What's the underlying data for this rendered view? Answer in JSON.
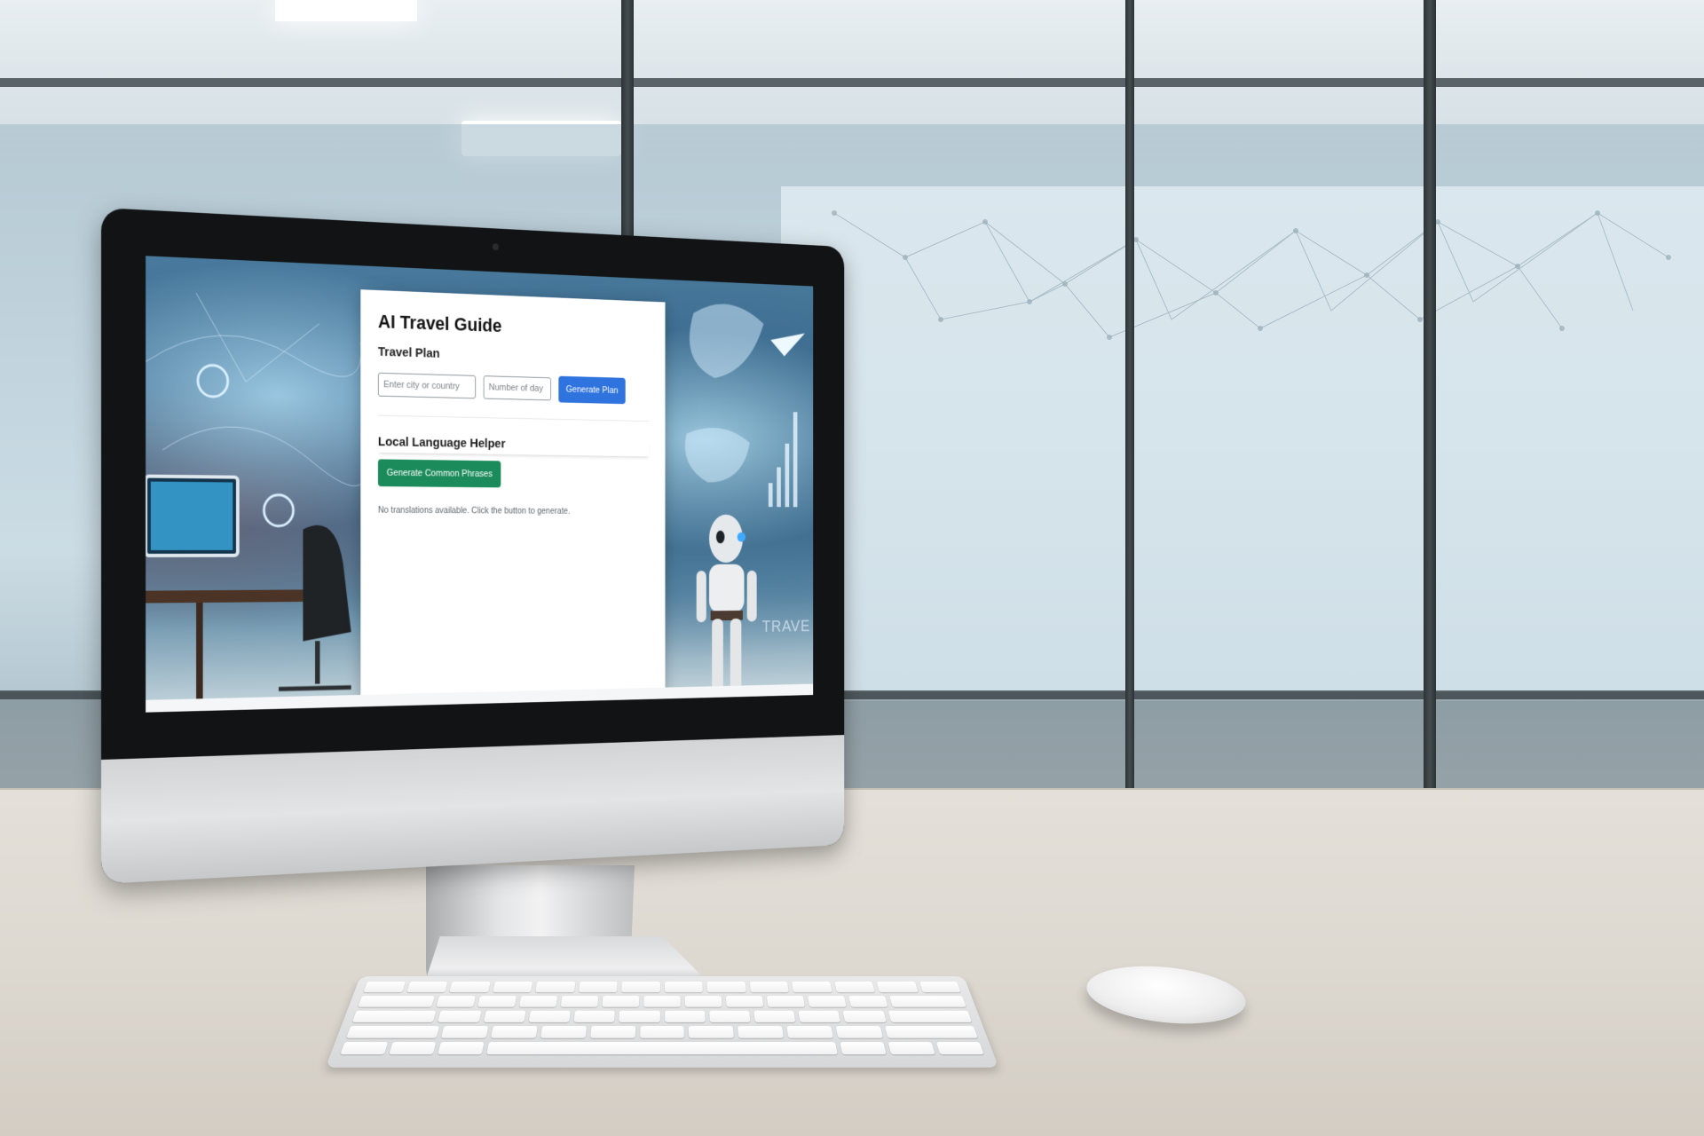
{
  "app": {
    "title": "AI Travel Guide"
  },
  "travel_plan": {
    "heading": "Travel Plan",
    "city_placeholder": "Enter city or country",
    "days_placeholder": "Number of day",
    "generate_label": "Generate Plan"
  },
  "language_helper": {
    "heading": "Local Language Helper",
    "generate_label": "Generate Common Phrases",
    "empty_message": "No translations available. Click the button to generate."
  },
  "hero_art": {
    "watermark_text": "TRAVE"
  },
  "colors": {
    "primary_button": "#2f73df",
    "secondary_button": "#1c8b5c",
    "card_background": "#ffffff",
    "bezel": "#111315"
  }
}
